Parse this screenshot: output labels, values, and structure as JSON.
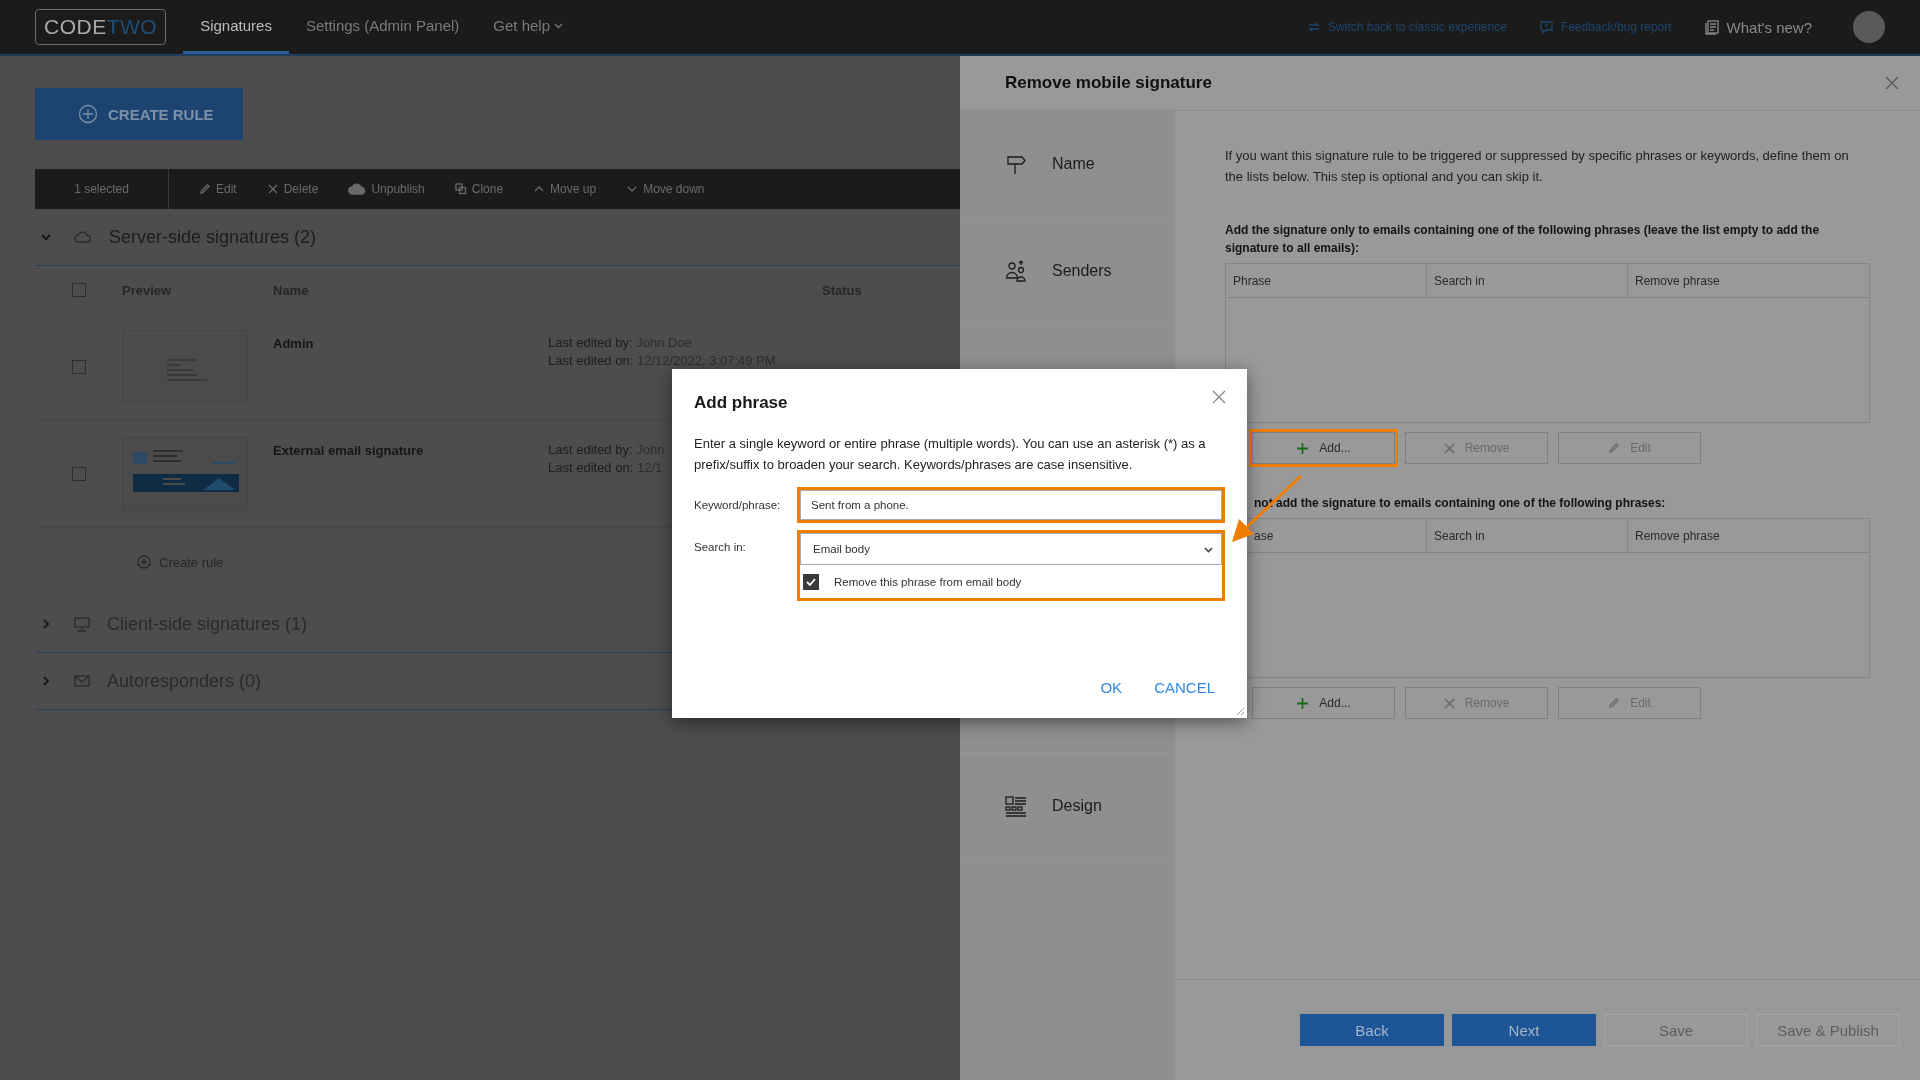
{
  "top_bar": {
    "logo": {
      "part_1": "CODE",
      "part_2": "TWO"
    },
    "tabs": [
      {
        "label": "Signatures",
        "selected": true
      },
      {
        "label": "Settings (Admin Panel)",
        "selected": false
      },
      {
        "label": "Get help",
        "selected": false,
        "kind": "menu"
      }
    ],
    "links": [
      {
        "label": "Switch back to classic experience",
        "kind": "switch"
      },
      {
        "label": "Feedback/bug report",
        "kind": "feedback"
      },
      {
        "label": "What's new?",
        "kind": "news"
      }
    ]
  },
  "create_rule_button": "CREATE RULE",
  "toolbar": {
    "selection": "1 selected",
    "actions": [
      {
        "label": "Edit",
        "kind": "edit"
      },
      {
        "label": "Delete",
        "kind": "delete"
      },
      {
        "label": "Unpublish",
        "kind": "unpublish"
      },
      {
        "label": "Clone",
        "kind": "clone"
      },
      {
        "label": "Move up",
        "kind": "up"
      },
      {
        "label": "Move down",
        "kind": "down"
      }
    ]
  },
  "sections": [
    {
      "title": "Server-side signatures (2)",
      "kind": "cloud",
      "expanded": true,
      "all_checked": false,
      "columns": [
        "Preview",
        "Name",
        "Status"
      ],
      "rows": [
        {
          "checked": false,
          "name": "Admin",
          "edited_by_label": "Last edited by:",
          "edited_by": "John Doe",
          "edited_on_label": "Last edited on:",
          "edited_on": "12/12/2022, 3:07:49 PM",
          "kind": "plain"
        },
        {
          "checked": false,
          "name": "External email signature",
          "edited_by_label": "Last edited by:",
          "edited_by": "John",
          "edited_on_label": "Last edited on:",
          "edited_on": "12/1",
          "kind": "banner"
        }
      ],
      "create_rule": "Create rule"
    },
    {
      "title": "Client-side signatures (1)",
      "kind": "monitor",
      "expanded": false
    },
    {
      "title": "Autoresponders (0)",
      "kind": "mail",
      "expanded": false
    }
  ],
  "drawer": {
    "title": "Remove mobile signature",
    "steps": [
      {
        "label": "Name",
        "kind": "name"
      },
      {
        "label": "Senders",
        "kind": "senders"
      },
      {
        "label": "Design",
        "kind": "design"
      }
    ],
    "intro": "If you want this signature rule to be triggered or suppressed by specific phrases or keywords, define them on the lists below. This step is optional and you can skip it.",
    "lists": [
      {
        "heading": "Add the signature only to emails containing one of the following phrases (leave the list empty to add the signature to all emails):",
        "columns": [
          "Phrase",
          "Search in",
          "Remove phrase"
        ],
        "buttons": [
          {
            "label": "Add...",
            "kind": "add",
            "highlighted": true,
            "disabled": false
          },
          {
            "label": "Remove",
            "kind": "remove",
            "highlighted": false,
            "disabled": true
          },
          {
            "label": "Edit",
            "kind": "edit",
            "highlighted": false,
            "disabled": true
          }
        ]
      },
      {
        "heading": "not add the signature to emails containing one of the following phrases:",
        "columns": [
          "ase",
          "Search in",
          "Remove phrase"
        ],
        "buttons": [
          {
            "label": "Add...",
            "kind": "add",
            "highlighted": false,
            "disabled": false
          },
          {
            "label": "Remove",
            "kind": "remove",
            "highlighted": false,
            "disabled": true
          },
          {
            "label": "Edit",
            "kind": "edit",
            "highlighted": false,
            "disabled": true
          }
        ]
      }
    ],
    "footer_buttons": [
      {
        "label": "Back",
        "disabled": false
      },
      {
        "label": "Next",
        "disabled": false
      },
      {
        "label": "Save",
        "disabled": true
      },
      {
        "label": "Save & Publish",
        "disabled": true
      }
    ]
  },
  "modal": {
    "title": "Add phrase",
    "description": "Enter a single keyword or entire phrase (multiple words). You can use an asterisk (*) as a prefix/suffix to broaden your search. Keywords/phrases are case insensitive.",
    "keyword": {
      "label": "Keyword/phrase:",
      "value": "Sent from a phone.",
      "highlighted": true
    },
    "search": {
      "label": "Search in:",
      "value": "Email body",
      "highlighted": true,
      "checkbox": {
        "label": "Remove this phrase from email body",
        "checked": true
      }
    },
    "buttons": [
      "OK",
      "CANCEL"
    ]
  }
}
